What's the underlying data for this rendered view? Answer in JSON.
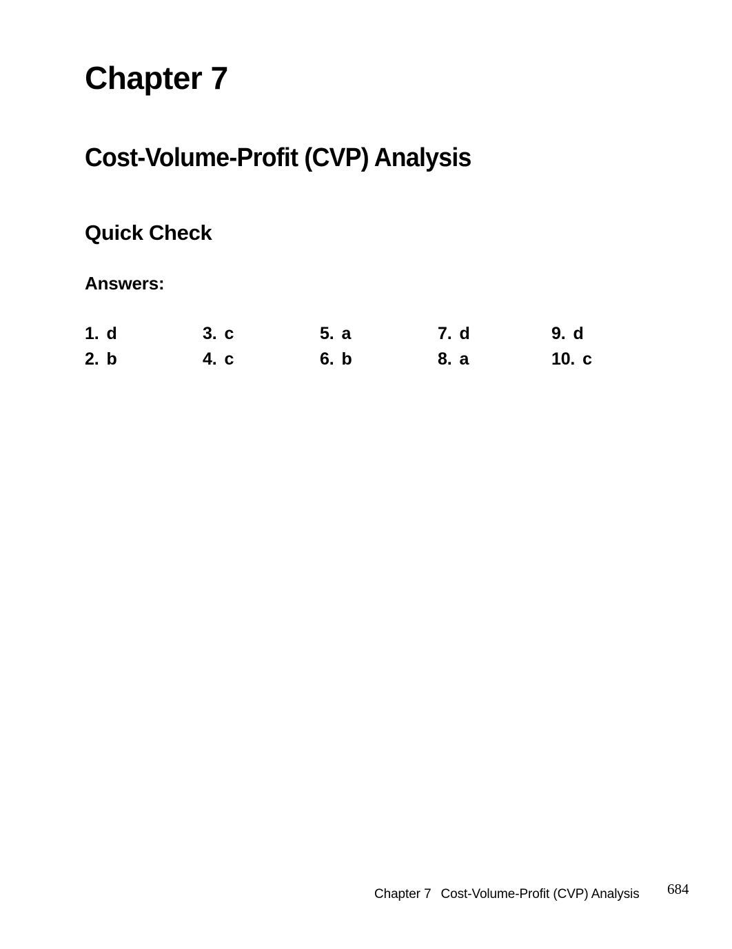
{
  "document": {
    "chapter_title": "Chapter 7",
    "doc_title": "Cost-Volume-Profit (CVP) Analysis",
    "section_heading": "Quick Check",
    "subsection_heading": "Answers:"
  },
  "answers": {
    "columns": [
      {
        "items": [
          {
            "number": "1.",
            "letter": "d"
          },
          {
            "number": "2.",
            "letter": "b"
          }
        ]
      },
      {
        "items": [
          {
            "number": "3.",
            "letter": "c"
          },
          {
            "number": "4.",
            "letter": "c"
          }
        ]
      },
      {
        "items": [
          {
            "number": "5.",
            "letter": "a"
          },
          {
            "number": "6.",
            "letter": "b"
          }
        ]
      },
      {
        "items": [
          {
            "number": "7.",
            "letter": "d"
          },
          {
            "number": "8.",
            "letter": "a"
          }
        ]
      },
      {
        "items": [
          {
            "number": "9.",
            "letter": "d"
          },
          {
            "number": "10.",
            "letter": "c"
          }
        ]
      }
    ]
  },
  "footer": {
    "chapter": "Chapter 7",
    "title": "Cost-Volume-Profit (CVP) Analysis",
    "page_number": "684"
  },
  "colors": {
    "text": "#000000",
    "background": "#ffffff"
  }
}
